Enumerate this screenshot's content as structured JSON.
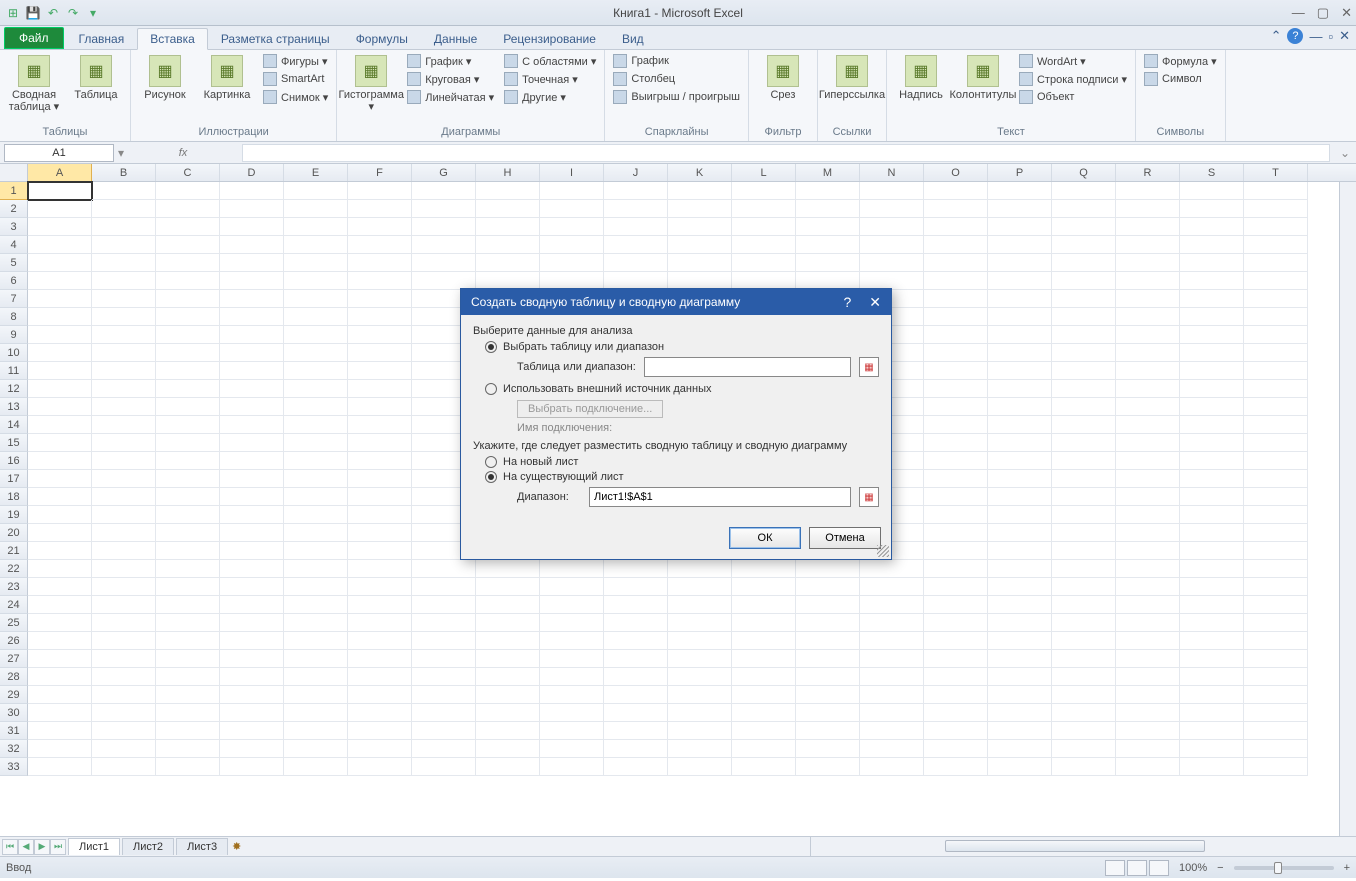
{
  "app": {
    "title": "Книга1  -  Microsoft Excel"
  },
  "tabs": {
    "file": "Файл",
    "items": [
      "Главная",
      "Вставка",
      "Разметка страницы",
      "Формулы",
      "Данные",
      "Рецензирование",
      "Вид"
    ],
    "active_index": 1
  },
  "ribbon": {
    "groups": [
      {
        "label": "Таблицы",
        "big": [
          {
            "label": "Сводная таблица ▾"
          },
          {
            "label": "Таблица"
          }
        ]
      },
      {
        "label": "Иллюстрации",
        "big": [
          {
            "label": "Рисунок"
          },
          {
            "label": "Картинка"
          }
        ],
        "small": [
          "Фигуры ▾",
          "SmartArt",
          "Снимок ▾"
        ]
      },
      {
        "label": "Диаграммы",
        "big": [
          {
            "label": "Гистограмма ▾"
          }
        ],
        "small": [
          "График ▾",
          "Круговая ▾",
          "Линейчатая ▾",
          "С областями ▾",
          "Точечная ▾",
          "Другие ▾"
        ]
      },
      {
        "label": "Спарклайны",
        "small": [
          "График",
          "Столбец",
          "Выигрыш / проигрыш"
        ]
      },
      {
        "label": "Фильтр",
        "big": [
          {
            "label": "Срез"
          }
        ]
      },
      {
        "label": "Ссылки",
        "big": [
          {
            "label": "Гиперссылка"
          }
        ]
      },
      {
        "label": "Текст",
        "big": [
          {
            "label": "Надпись"
          },
          {
            "label": "Колонтитулы"
          }
        ],
        "small": [
          "WordArt ▾",
          "Строка подписи ▾",
          "Объект"
        ]
      },
      {
        "label": "Символы",
        "small": [
          "Формула ▾",
          "Символ"
        ]
      }
    ]
  },
  "namebox": "A1",
  "columns": [
    "A",
    "B",
    "C",
    "D",
    "E",
    "F",
    "G",
    "H",
    "I",
    "J",
    "K",
    "L",
    "M",
    "N",
    "O",
    "P",
    "Q",
    "R",
    "S",
    "T"
  ],
  "rowcount": 33,
  "sheets": [
    "Лист1",
    "Лист2",
    "Лист3"
  ],
  "status": {
    "left": "Ввод",
    "zoom": "100%"
  },
  "dialog": {
    "title": "Создать сводную таблицу и сводную диаграмму",
    "section1": "Выберите данные для анализа",
    "opt1": "Выбрать таблицу или диапазон",
    "table_label": "Таблица или диапазон:",
    "table_value": "",
    "opt2": "Использовать внешний источник данных",
    "choose_conn": "Выбрать подключение...",
    "conn_label": "Имя подключения:",
    "section2": "Укажите, где следует разместить сводную таблицу и сводную диаграмму",
    "opt3": "На новый лист",
    "opt4": "На существующий лист",
    "range_label": "Диапазон:",
    "range_value": "Лист1!$A$1",
    "ok": "ОК",
    "cancel": "Отмена"
  }
}
